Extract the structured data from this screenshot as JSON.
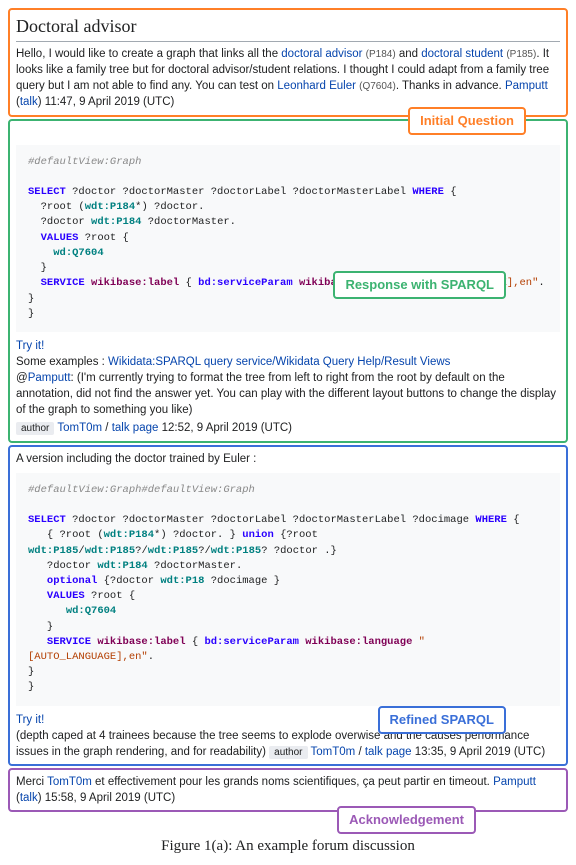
{
  "section_title": "Doctoral advisor",
  "q1": {
    "pre": "Hello, I would like to create a graph that links all the ",
    "l1": "doctoral advisor",
    "p1": "(P184)",
    "mid1": " and ",
    "l2": "doctoral student",
    "p2": "(P185)",
    "post1": ". It looks like a family tree but for doctoral advisor/student relations. I thought I could adapt from a family tree query but I am not able to find any. You can test on ",
    "l3": "Leonhard Euler",
    "p3": "(Q7604)",
    "post2": ". Thanks in advance. ",
    "sig_user": "Pamputt",
    "sig_talk": "talk",
    "sig_time": "11:47, 9 April 2019 (UTC)"
  },
  "code1": {
    "c0": "#defaultView:Graph",
    "l1a": "SELECT",
    "l1b": " ?doctor ?doctorMaster ?doctorLabel ?doctorMasterLabel ",
    "l1c": "WHERE",
    "l1d": " {",
    "l2": "  ?root (",
    "l2p": "wdt:P184",
    "l2b": "*) ?doctor.",
    "l3": "  ?doctor ",
    "l3p": "wdt:P184",
    "l3b": " ?doctorMaster.",
    "l4": "  ",
    "l4v": "VALUES",
    "l4b": " ?root {",
    "l5": "    ",
    "l5p": "wd:Q7604",
    "l6": "  }",
    "l7": "  ",
    "l7s": "SERVICE",
    "l7w": " wikibase:label",
    "l7b": " { ",
    "l7bd": "bd:serviceParam",
    "l7wl": " wikibase:language",
    "l7str": " \"[AUTO_LANGUAGE],en\"",
    "l7e": ". }",
    "l8": "}"
  },
  "resp1": {
    "try": "Try it!",
    "ex_pre": "Some examples : ",
    "ex_link": "Wikidata:SPARQL query service/Wikidata Query Help/Result Views",
    "at": "@",
    "at_user": "Pamputt",
    "body": ": (I'm currently trying to format the tree from left to right from the root by default on the annotation, did not find the answer yet. You can play with the different layout buttons to change the display of the graph to something you like)",
    "author_label": "author",
    "author": "TomT0m",
    "sep": " / ",
    "talk": "talk",
    "page": "page",
    "time": "12:52, 9 April 2019 (UTC)"
  },
  "resp2_intro": "A version including the doctor trained by Euler :",
  "code2": {
    "c0": "#defaultView:Graph#defaultView:Graph",
    "l1a": "SELECT",
    "l1b": " ?doctor ?doctorMaster ?doctorLabel ?doctorMasterLabel ?docimage ",
    "l1c": "WHERE",
    "l1d": " {",
    "l2": "   { ?root (",
    "l2p": "wdt:P184",
    "l2b": "*) ?doctor. } ",
    "l2u": "union",
    "l2c": " {?root",
    "l3p": "wdt:P185",
    "l3s": "/",
    "l3q": "?/",
    "l3e": "? ?doctor .}",
    "l4": "   ?doctor ",
    "l4p": "wdt:P184",
    "l4b": " ?doctorMaster.",
    "l5": "   ",
    "l5o": "optional",
    "l5b": " {?doctor ",
    "l5p": "wdt:P18",
    "l5c": " ?docimage }",
    "l6": "   ",
    "l6v": "VALUES",
    "l6b": " ?root {",
    "l7": "      ",
    "l7p": "wd:Q7604",
    "l8": "   }",
    "l9": "   ",
    "l9s": "SERVICE",
    "l9w": " wikibase:label",
    "l9b": " { ",
    "l9bd": "bd:serviceParam",
    "l9wl": " wikibase:language",
    "l9str": " \"[AUTO_LANGUAGE],en\"",
    "l9e": ".",
    "l10": "}",
    "l11": "}"
  },
  "resp2": {
    "try": "Try it!",
    "body": "(depth caped at 4 trainees because the tree seems to explode overwise and the causes performance issues in the graph rendering, and for readability)",
    "author_label": "author",
    "author": "TomT0m",
    "sep": " / ",
    "talk": "talk",
    "page": "page",
    "time": "13:35, 9 April 2019 (UTC)"
  },
  "ack": {
    "pre": "Merci ",
    "user1": "TomT0m",
    "body": " et effectivement pour les grands noms scientifiques, ça peut partir en timeout. ",
    "user2": "Pamputt",
    "talk": "talk",
    "time": "15:58, 9 April 2019 (UTC)"
  },
  "labels": {
    "orange": "Initial Question",
    "green": "Response with SPARQL",
    "blue": "Refined SPARQL",
    "purple": "Acknowledgement"
  },
  "caption": "Figure 1(a): An example forum discussion"
}
